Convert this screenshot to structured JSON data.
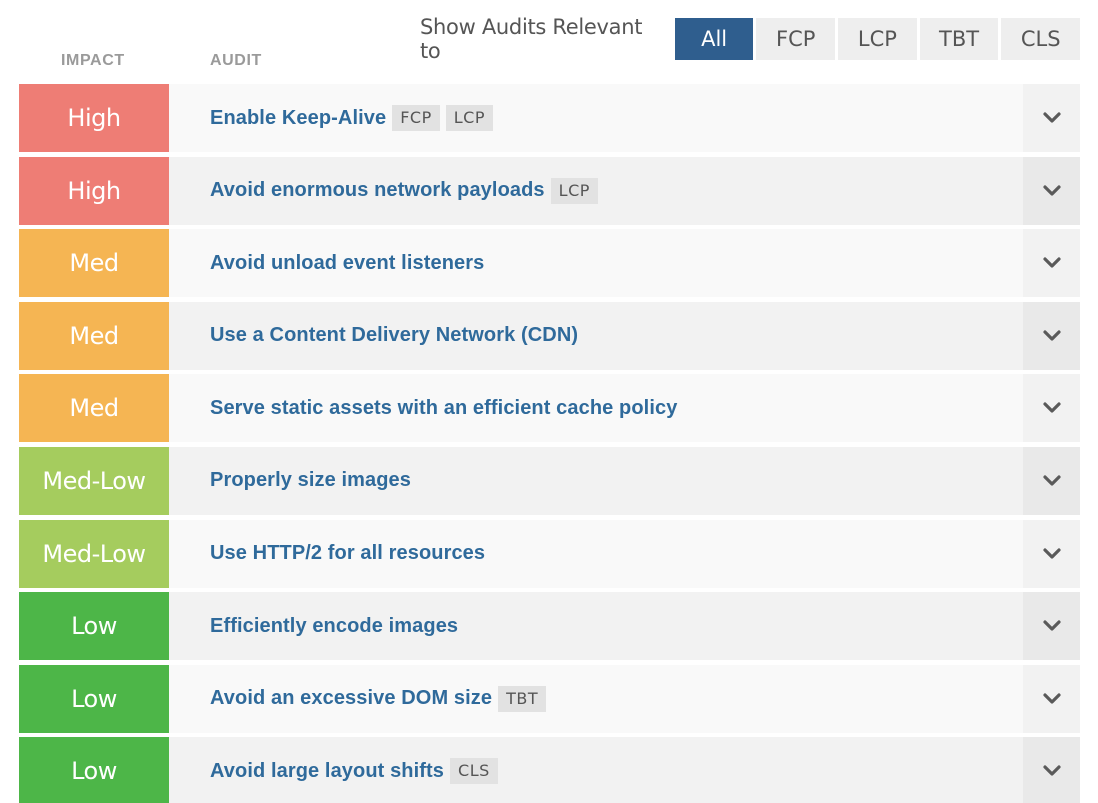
{
  "headers": {
    "impact": "IMPACT",
    "audit": "AUDIT"
  },
  "filter": {
    "label": "Show Audits Relevant to",
    "options": [
      "All",
      "FCP",
      "LCP",
      "TBT",
      "CLS"
    ],
    "selected": "All"
  },
  "colors": {
    "high": "#ee7d75",
    "med": "#f5b553",
    "med_low": "#a5cc5e",
    "low": "#4db648",
    "accent": "#2f5e8e",
    "link": "#2f6a9b"
  },
  "audits": [
    {
      "impact": "High",
      "level": "high",
      "title": "Enable Keep-Alive",
      "tags": [
        "FCP",
        "LCP"
      ]
    },
    {
      "impact": "High",
      "level": "high",
      "title": "Avoid enormous network payloads",
      "tags": [
        "LCP"
      ]
    },
    {
      "impact": "Med",
      "level": "med",
      "title": "Avoid unload event listeners",
      "tags": []
    },
    {
      "impact": "Med",
      "level": "med",
      "title": "Use a Content Delivery Network (CDN)",
      "tags": []
    },
    {
      "impact": "Med",
      "level": "med",
      "title": "Serve static assets with an efficient cache policy",
      "tags": []
    },
    {
      "impact": "Med-Low",
      "level": "med_low",
      "title": "Properly size images",
      "tags": []
    },
    {
      "impact": "Med-Low",
      "level": "med_low",
      "title": "Use HTTP/2 for all resources",
      "tags": []
    },
    {
      "impact": "Low",
      "level": "low",
      "title": "Efficiently encode images",
      "tags": []
    },
    {
      "impact": "Low",
      "level": "low",
      "title": "Avoid an excessive DOM size",
      "tags": [
        "TBT"
      ]
    },
    {
      "impact": "Low",
      "level": "low",
      "title": "Avoid large layout shifts",
      "tags": [
        "CLS"
      ]
    }
  ],
  "icons": {
    "expander": "chevron-down-icon"
  }
}
